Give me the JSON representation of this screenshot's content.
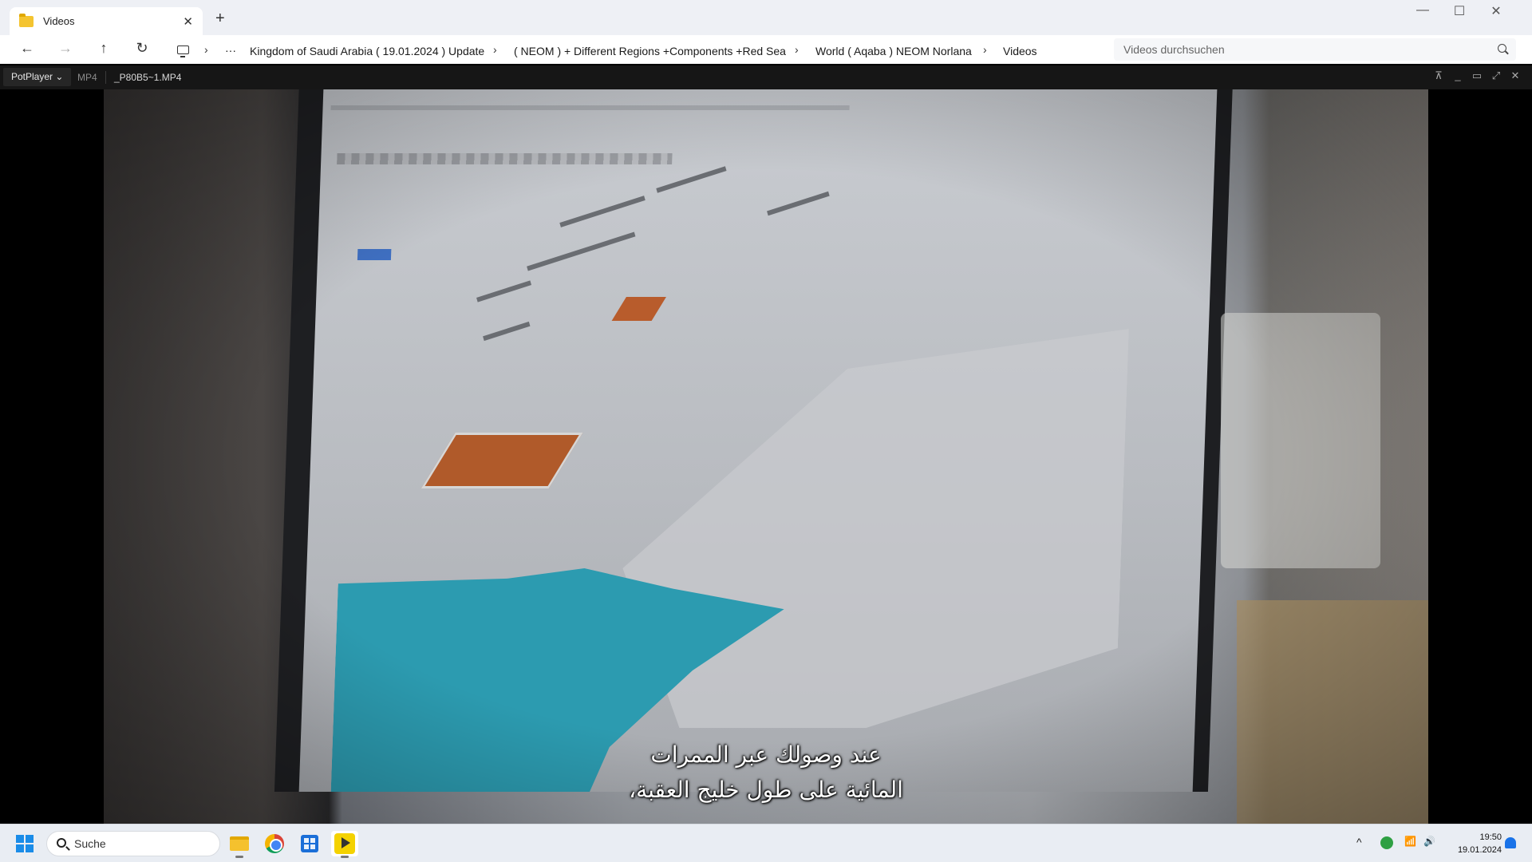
{
  "explorer": {
    "tab_title": "Videos",
    "tab_close": "✕",
    "new_tab": "+",
    "window_controls": {
      "minimize": "—",
      "maximize": "☐",
      "close": "✕"
    },
    "nav": {
      "back": "←",
      "forward": "→",
      "up": "↑",
      "refresh": "↻",
      "more": "···",
      "chevron": "›"
    },
    "breadcrumb": [
      "Kingdom of Saudi Arabia ( 19.01.2024 ) Update",
      "( NEOM ) + Different Regions +Components +Red Sea",
      "World ( Aqaba ) NEOM Norlana",
      "Videos"
    ],
    "search_placeholder": "Videos durchsuchen"
  },
  "potplayer": {
    "menu_label": "PotPlayer ⌄",
    "format": "MP4",
    "filename": "_P80B5~1.MP4",
    "controls": {
      "pin": "⊼",
      "minimize": "_",
      "maximize": "▭",
      "fullscreen": "⤢",
      "close": "✕"
    }
  },
  "video": {
    "subtitle_line1": "عند وصولك عبر الممرات",
    "subtitle_line2": "المائية على طول خليج العقبة،"
  },
  "taskbar": {
    "search_placeholder": "Suche",
    "apps": [
      "file-explorer",
      "chrome",
      "microsoft-store",
      "potplayer"
    ],
    "tray": {
      "chevron": "^",
      "wifi": "📶",
      "volume": "🔊"
    },
    "time": "19:50",
    "date": "19.01.2024"
  },
  "colors": {
    "accent": "#1a8ce8",
    "player_bg": "#161616",
    "sea": "#2c9bb0"
  }
}
